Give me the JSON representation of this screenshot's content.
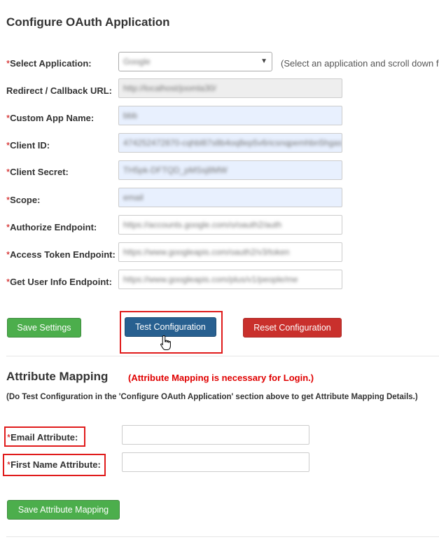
{
  "configure": {
    "title": "Configure OAuth Application",
    "select_application": {
      "required_mark": "*",
      "label": "Select Application:",
      "value": "Google",
      "hint": "(Select an application and scroll down f"
    },
    "redirect_url": {
      "label": "Redirect / Callback URL:",
      "value": "http://localhost/joomla30/"
    },
    "custom_app_name": {
      "required_mark": "*",
      "label": "Custom App Name:",
      "value": "bbb"
    },
    "client_id": {
      "required_mark": "*",
      "label": "Client ID:",
      "value": "474252472870-cqhbl87s8b4oq8ep5v6ricsnqpemhbn5hgas"
    },
    "client_secret": {
      "required_mark": "*",
      "label": "Client Secret:",
      "value": "TH5pk-DFTQD_pMSsj8MW"
    },
    "scope": {
      "required_mark": "*",
      "label": "Scope:",
      "value": "email"
    },
    "authorize_endpoint": {
      "required_mark": "*",
      "label": "Authorize Endpoint:",
      "value": "https://accounts.google.com/o/oauth2/auth"
    },
    "access_token_endpoint": {
      "required_mark": "*",
      "label": "Access Token Endpoint:",
      "value": "https://www.googleapis.com/oauth2/v3/token"
    },
    "user_info_endpoint": {
      "required_mark": "*",
      "label": "Get User Info Endpoint:",
      "value": "https://www.googleapis.com/plus/v1/people/me"
    },
    "buttons": {
      "save": "Save Settings",
      "test": "Test Configuration",
      "reset": "Reset Configuration"
    }
  },
  "attribute_mapping": {
    "title": "Attribute Mapping",
    "warning": "(Attribute Mapping is necessary for Login.)",
    "note": "(Do Test Configuration in the 'Configure OAuth Application' section above to get Attribute Mapping Details.)",
    "email": {
      "required_mark": "*",
      "label": "Email Attribute:",
      "value": ""
    },
    "first_name": {
      "required_mark": "*",
      "label": "First Name Attribute:",
      "value": ""
    },
    "save_button": "Save Attribute Mapping"
  },
  "colors": {
    "required": "#cc0000",
    "highlight": "#e01b1b",
    "save_green": "#4cae4c",
    "test_blue": "#286090",
    "reset_red": "#c9302c"
  },
  "icons": {
    "cursor": "hand-pointer-icon",
    "dropdown": "caret-down-icon"
  }
}
